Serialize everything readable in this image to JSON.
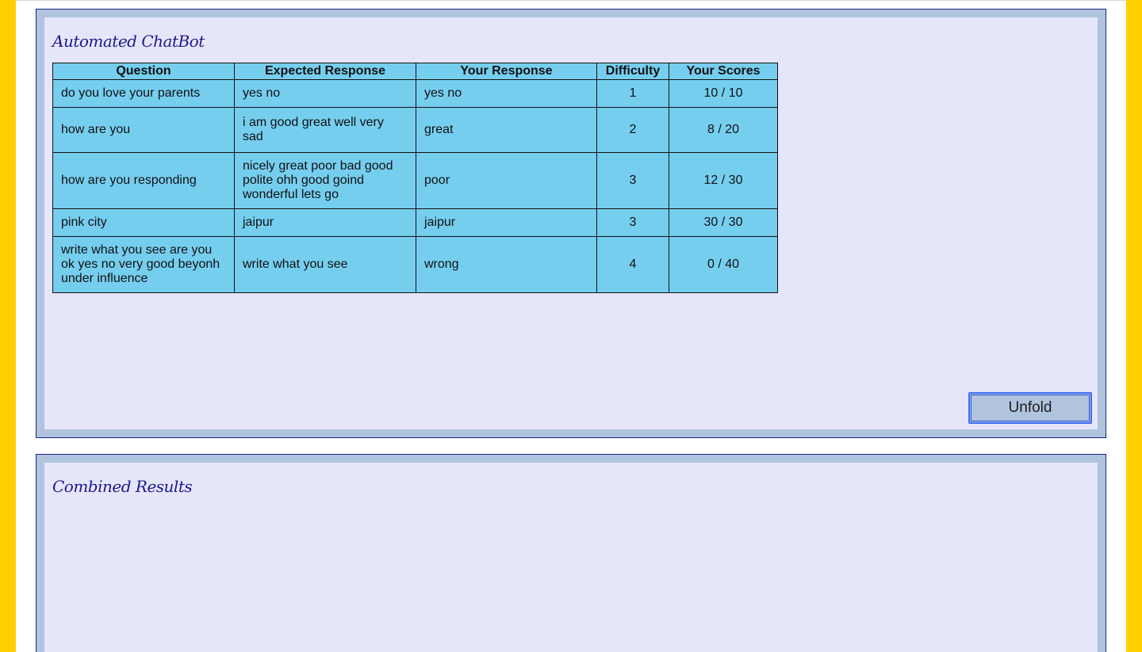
{
  "panels": {
    "chatbot": {
      "title": "Automated ChatBot",
      "unfold_label": "Unfold"
    },
    "combined": {
      "title": "Combined Results"
    }
  },
  "table": {
    "headers": [
      "Question",
      "Expected Response",
      "Your Response",
      "Difficulty",
      "Your Scores"
    ],
    "rows": [
      {
        "question": "do you love your parents",
        "expected": "yes no",
        "response": "yes no",
        "difficulty": "1",
        "score": "10 / 10"
      },
      {
        "question": "how are you",
        "expected": "i am good great well very sad",
        "response": "great",
        "difficulty": "2",
        "score": "8 / 20"
      },
      {
        "question": "how are you responding",
        "expected": "nicely great poor bad good polite ohh good goind wonderful lets go",
        "response": "poor",
        "difficulty": "3",
        "score": "12 / 30"
      },
      {
        "question": "pink city",
        "expected": "jaipur",
        "response": "jaipur",
        "difficulty": "3",
        "score": "30 / 30"
      },
      {
        "question": "write what you see are you ok yes no very good beyonh under influence",
        "expected": "write what you see",
        "response": "wrong",
        "difficulty": "4",
        "score": "0 / 40"
      }
    ]
  },
  "colors": {
    "side_bars": "#ffd000",
    "panel_border": "#b0c4de",
    "panel_background": "#e6e6fa",
    "table_background": "#76ceef",
    "title_text": "#1a1a8c"
  }
}
